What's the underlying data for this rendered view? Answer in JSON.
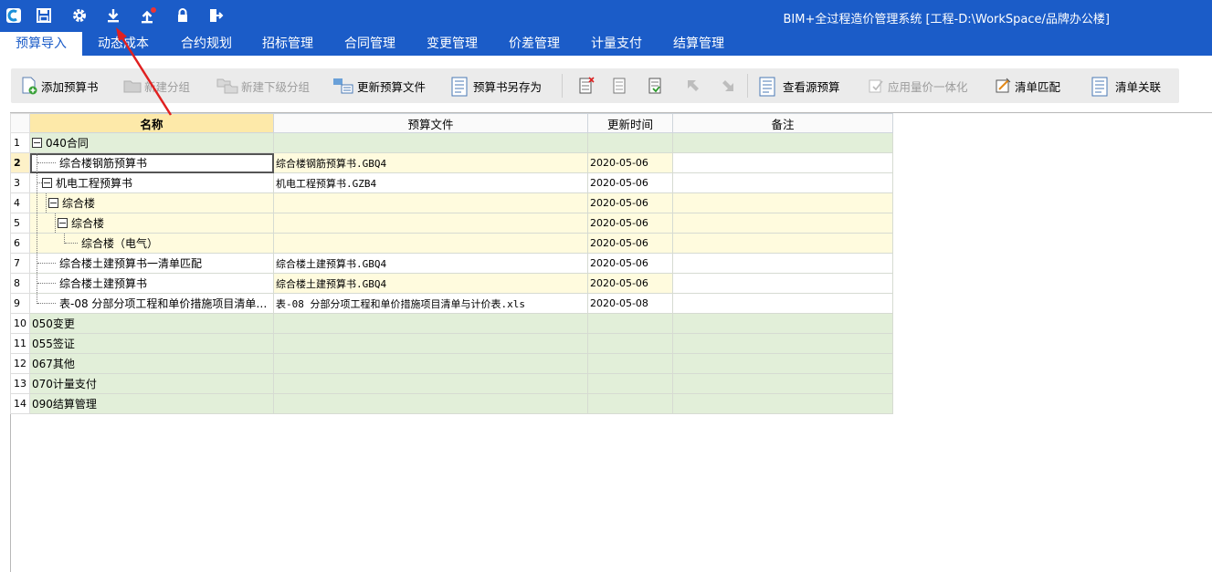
{
  "app": {
    "title": "BIM+全过程造价管理系统 [工程-D:\\WorkSpace/品牌办公楼]"
  },
  "quick_access": [
    "app-logo-icon",
    "save-icon",
    "settings-gear-icon",
    "download-icon",
    "upload-icon",
    "lock-icon",
    "exit-icon"
  ],
  "menu": {
    "tabs": [
      "预算导入",
      "动态成本",
      "合约规划",
      "招标管理",
      "合同管理",
      "变更管理",
      "价差管理",
      "计量支付",
      "结算管理"
    ],
    "active": "预算导入"
  },
  "toolbar": {
    "add_budget": "添加预算书",
    "new_group": "新建分组",
    "new_subgroup": "新建下级分组",
    "update_budget_file": "更新预算文件",
    "save_budget_as": "预算书另存为",
    "view_source_budget": "查看源预算",
    "apply_qty_price": "应用量价一体化",
    "list_match": "清单匹配",
    "list_link": "清单关联"
  },
  "grid": {
    "headers": {
      "name": "名称",
      "file": "预算文件",
      "updated": "更新时间",
      "note": "备注"
    },
    "rows": [
      {
        "n": "1",
        "name": "040合同",
        "file": "",
        "date": "",
        "note": ""
      },
      {
        "n": "2",
        "name": "综合楼钢筋预算书",
        "file": "综合楼钢筋预算书.GBQ4",
        "date": "2020-05-06",
        "note": ""
      },
      {
        "n": "3",
        "name": "机电工程预算书",
        "file": "机电工程预算书.GZB4",
        "date": "2020-05-06",
        "note": ""
      },
      {
        "n": "4",
        "name": "综合楼",
        "file": "",
        "date": "2020-05-06",
        "note": ""
      },
      {
        "n": "5",
        "name": "综合楼",
        "file": "",
        "date": "2020-05-06",
        "note": ""
      },
      {
        "n": "6",
        "name": "综合楼（电气）",
        "file": "",
        "date": "2020-05-06",
        "note": ""
      },
      {
        "n": "7",
        "name": "综合楼土建预算书一清单匹配",
        "file": "综合楼土建预算书.GBQ4",
        "date": "2020-05-06",
        "note": ""
      },
      {
        "n": "8",
        "name": "综合楼土建预算书",
        "file": "综合楼土建预算书.GBQ4",
        "date": "2020-05-06",
        "note": ""
      },
      {
        "n": "9",
        "name": "表-08 分部分项工程和单价措施项目清单…",
        "file": "表-08 分部分项工程和单价措施项目清单与计价表.xls",
        "date": "2020-05-08",
        "note": ""
      },
      {
        "n": "10",
        "name": "050变更",
        "file": "",
        "date": "",
        "note": ""
      },
      {
        "n": "11",
        "name": "055签证",
        "file": "",
        "date": "",
        "note": ""
      },
      {
        "n": "12",
        "name": "067其他",
        "file": "",
        "date": "",
        "note": ""
      },
      {
        "n": "13",
        "name": "070计量支付",
        "file": "",
        "date": "",
        "note": ""
      },
      {
        "n": "14",
        "name": "090结算管理",
        "file": "",
        "date": "",
        "note": ""
      }
    ]
  },
  "colors": {
    "titlebar": "#1b5cc8",
    "group_row": "#e2efd9",
    "item_row": "#fffbde",
    "annotation_arrow": "#e02020"
  }
}
